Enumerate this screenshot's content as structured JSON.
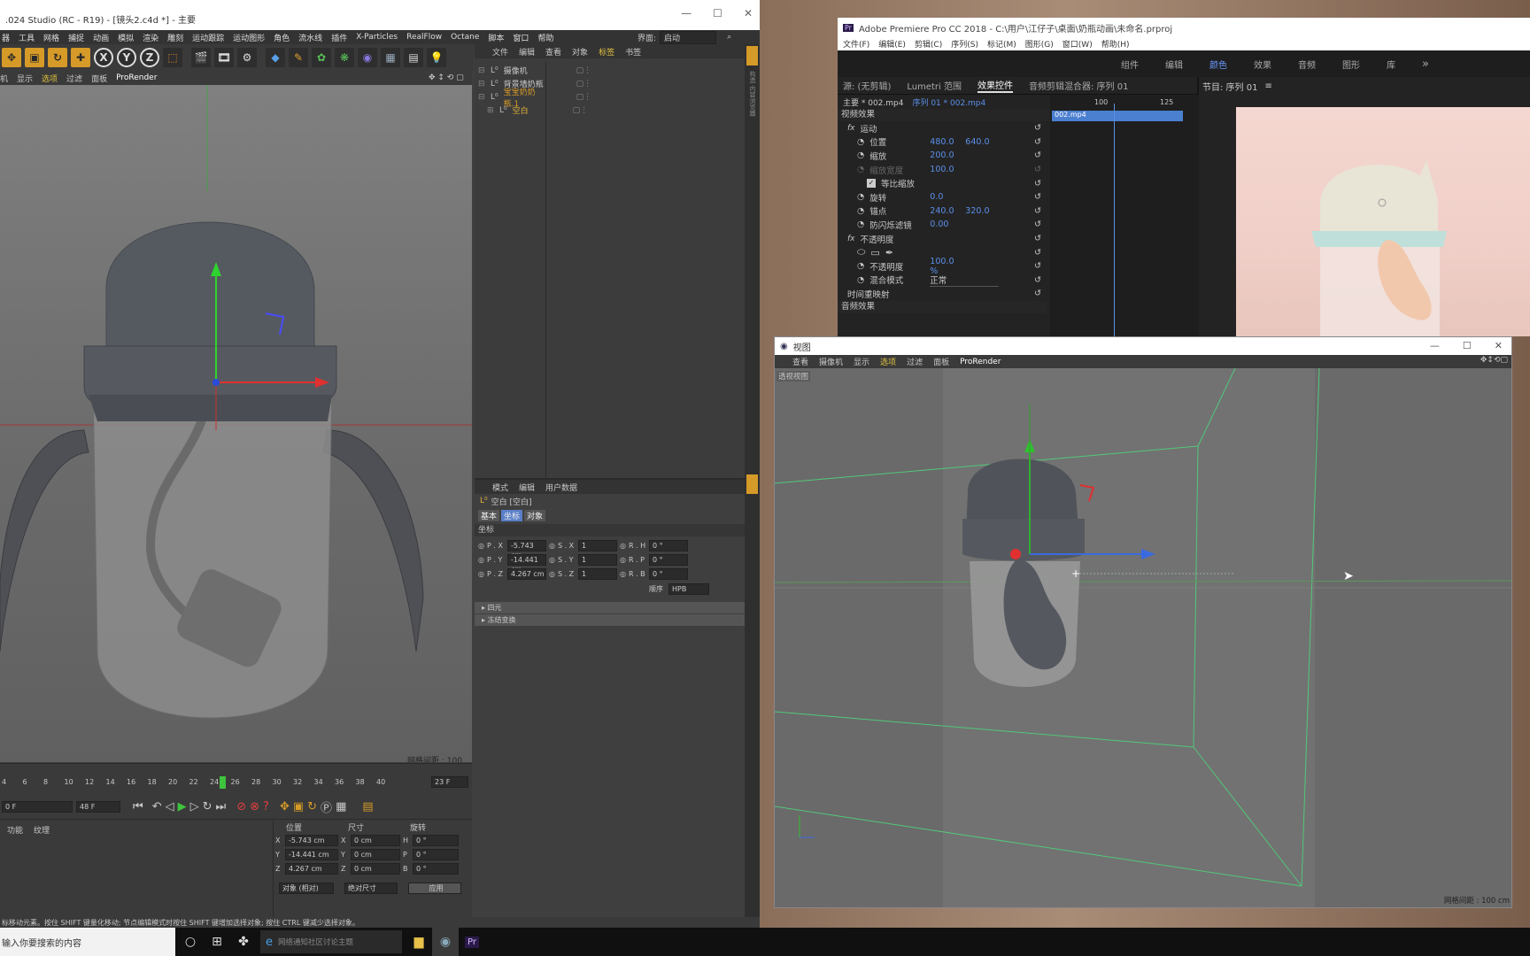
{
  "c4d": {
    "title": ".024 Studio (RC - R19) - [镜头2.c4d *] - 主要",
    "menu": [
      "器",
      "工具",
      "网格",
      "捕捉",
      "动画",
      "模拟",
      "渲染",
      "雕刻",
      "运动跟踪",
      "运动图形",
      "角色",
      "流水线",
      "插件",
      "X-Particles",
      "RealFlow",
      "Octane",
      "脚本",
      "窗口",
      "帮助"
    ],
    "interface_label": "界面:",
    "interface_value": "启动",
    "tools": [
      "X",
      "Y",
      "Z"
    ],
    "viewport_menu": [
      "机",
      "显示",
      "选项",
      "过滤",
      "面板",
      "ProRender"
    ],
    "grid_spacing": "网格间距 : 100 cm",
    "object_manager": {
      "menu": [
        "文件",
        "编辑",
        "查看",
        "对象",
        "标签",
        "书签"
      ],
      "items": [
        {
          "label": "摄像机",
          "color": "#c8c8c8"
        },
        {
          "label": "背景墙奶瓶",
          "color": "#c8c8c8"
        },
        {
          "label": "宝宝奶奶瓶.1",
          "color": "#d59a28"
        },
        {
          "label": "空白",
          "color": "#e2b23a"
        }
      ]
    },
    "attr": {
      "menu": [
        "模式",
        "编辑",
        "用户数据"
      ],
      "object": "空白 [空白]",
      "tabs": [
        "基本",
        "坐标",
        "对象"
      ],
      "section": "坐标",
      "rows": [
        {
          "p": "P . X",
          "pv": "-5.743 cm",
          "s": "S . X",
          "sv": "1",
          "r": "R . H",
          "rv": "0 °"
        },
        {
          "p": "P . Y",
          "pv": "-14.441 cm",
          "s": "S . Y",
          "sv": "1",
          "r": "R . P",
          "rv": "0 °"
        },
        {
          "p": "P . Z",
          "pv": "4.267 cm",
          "s": "S . Z",
          "sv": "1",
          "r": "R . B",
          "rv": "0 °"
        }
      ],
      "order_label": "顺序",
      "order_value": "HPB",
      "groups": [
        "四元",
        "冻结变换"
      ]
    },
    "timeline": {
      "ticks": [
        "4",
        "6",
        "8",
        "10",
        "12",
        "14",
        "16",
        "18",
        "20",
        "22",
        "24",
        "26",
        "28",
        "30",
        "32",
        "34",
        "36",
        "38",
        "40"
      ],
      "current_frame": "23 F",
      "start_field": "0 F",
      "end_field": "48 F",
      "end_field2": "48 F",
      "current_marker": "234"
    },
    "coords": {
      "left_tabs": [
        "功能",
        "纹理"
      ],
      "headers": [
        "位置",
        "尺寸",
        "旋转"
      ],
      "rows": [
        {
          "axis": "X",
          "pos": "-5.743 cm",
          "size": "0 cm",
          "rl": "H",
          "rot": "0 °"
        },
        {
          "axis": "Y",
          "pos": "-14.441 cm",
          "size": "0 cm",
          "rl": "P",
          "rot": "0 °"
        },
        {
          "axis": "Z",
          "pos": "4.267 cm",
          "size": "0 cm",
          "rl": "B",
          "rot": "0 °"
        }
      ],
      "mode1": "对象 (相对)",
      "mode2": "绝对尺寸",
      "apply": "应用"
    },
    "status": "标移动元素。按住 SHIFT 键量化移动; 节点编辑模式时按住 SHIFT 键增加选择对象; 按住 CTRL 键减少选择对象。"
  },
  "premiere": {
    "title": "Adobe Premiere Pro CC 2018 - C:\\用户\\江仔子\\桌面\\奶瓶动画\\未命名.prproj",
    "menu": [
      "文件(F)",
      "编辑(E)",
      "剪辑(C)",
      "序列(S)",
      "标记(M)",
      "图形(G)",
      "窗口(W)",
      "帮助(H)"
    ],
    "workspaces": [
      "组件",
      "编辑",
      "颜色",
      "效果",
      "音频",
      "图形",
      "库"
    ],
    "active_ws": "颜色",
    "panel_tabs": [
      "源: (无剪辑)",
      "Lumetri 范围",
      "效果控件",
      "音频剪辑混合器: 序列 01"
    ],
    "active_tab": "效果控件",
    "master": "主要 * 002.mp4",
    "seq": "序列 01 * 002.mp4",
    "video_fx": "视频效果",
    "ruler": [
      "100",
      "125"
    ],
    "clip": "002.mp4",
    "rows": [
      {
        "ind": 1,
        "label": "运动",
        "v1": "",
        "v2": "",
        "fx": true
      },
      {
        "ind": 2,
        "label": "位置",
        "v1": "480.0",
        "v2": "640.0"
      },
      {
        "ind": 2,
        "label": "缩放",
        "v1": "200.0",
        "v2": ""
      },
      {
        "ind": 2,
        "label": "缩放宽度",
        "v1": "100.0",
        "v2": "",
        "dim": true
      },
      {
        "ind": 3,
        "label": "等比缩放",
        "v1": "",
        "v2": "",
        "check": true
      },
      {
        "ind": 2,
        "label": "旋转",
        "v1": "0.0",
        "v2": ""
      },
      {
        "ind": 2,
        "label": "锚点",
        "v1": "240.0",
        "v2": "320.0"
      },
      {
        "ind": 2,
        "label": "防闪烁滤镜",
        "v1": "0.00",
        "v2": ""
      },
      {
        "ind": 1,
        "label": "不透明度",
        "v1": "",
        "v2": "",
        "fx": true
      },
      {
        "ind": 2,
        "label": "",
        "v1": "",
        "v2": "",
        "shapes": true
      },
      {
        "ind": 2,
        "label": "不透明度",
        "v1": "100.0 %",
        "v2": ""
      },
      {
        "ind": 2,
        "label": "混合模式",
        "v1": "正常",
        "v2": "",
        "select": true
      },
      {
        "ind": 1,
        "label": "时间重映射",
        "v1": "",
        "v2": ""
      }
    ],
    "audio_fx": "音频效果",
    "program": "节目: 序列 01"
  },
  "viewport": {
    "title": "视图",
    "menu": [
      "查看",
      "摄像机",
      "显示",
      "选项",
      "过滤",
      "面板",
      "ProRender"
    ],
    "label": "透视视图",
    "grid_spacing": "网格间距 : 100 cm"
  },
  "taskbar": {
    "search": "输入你要搜索的内容",
    "browser": "网络通知社区讨论主题"
  }
}
